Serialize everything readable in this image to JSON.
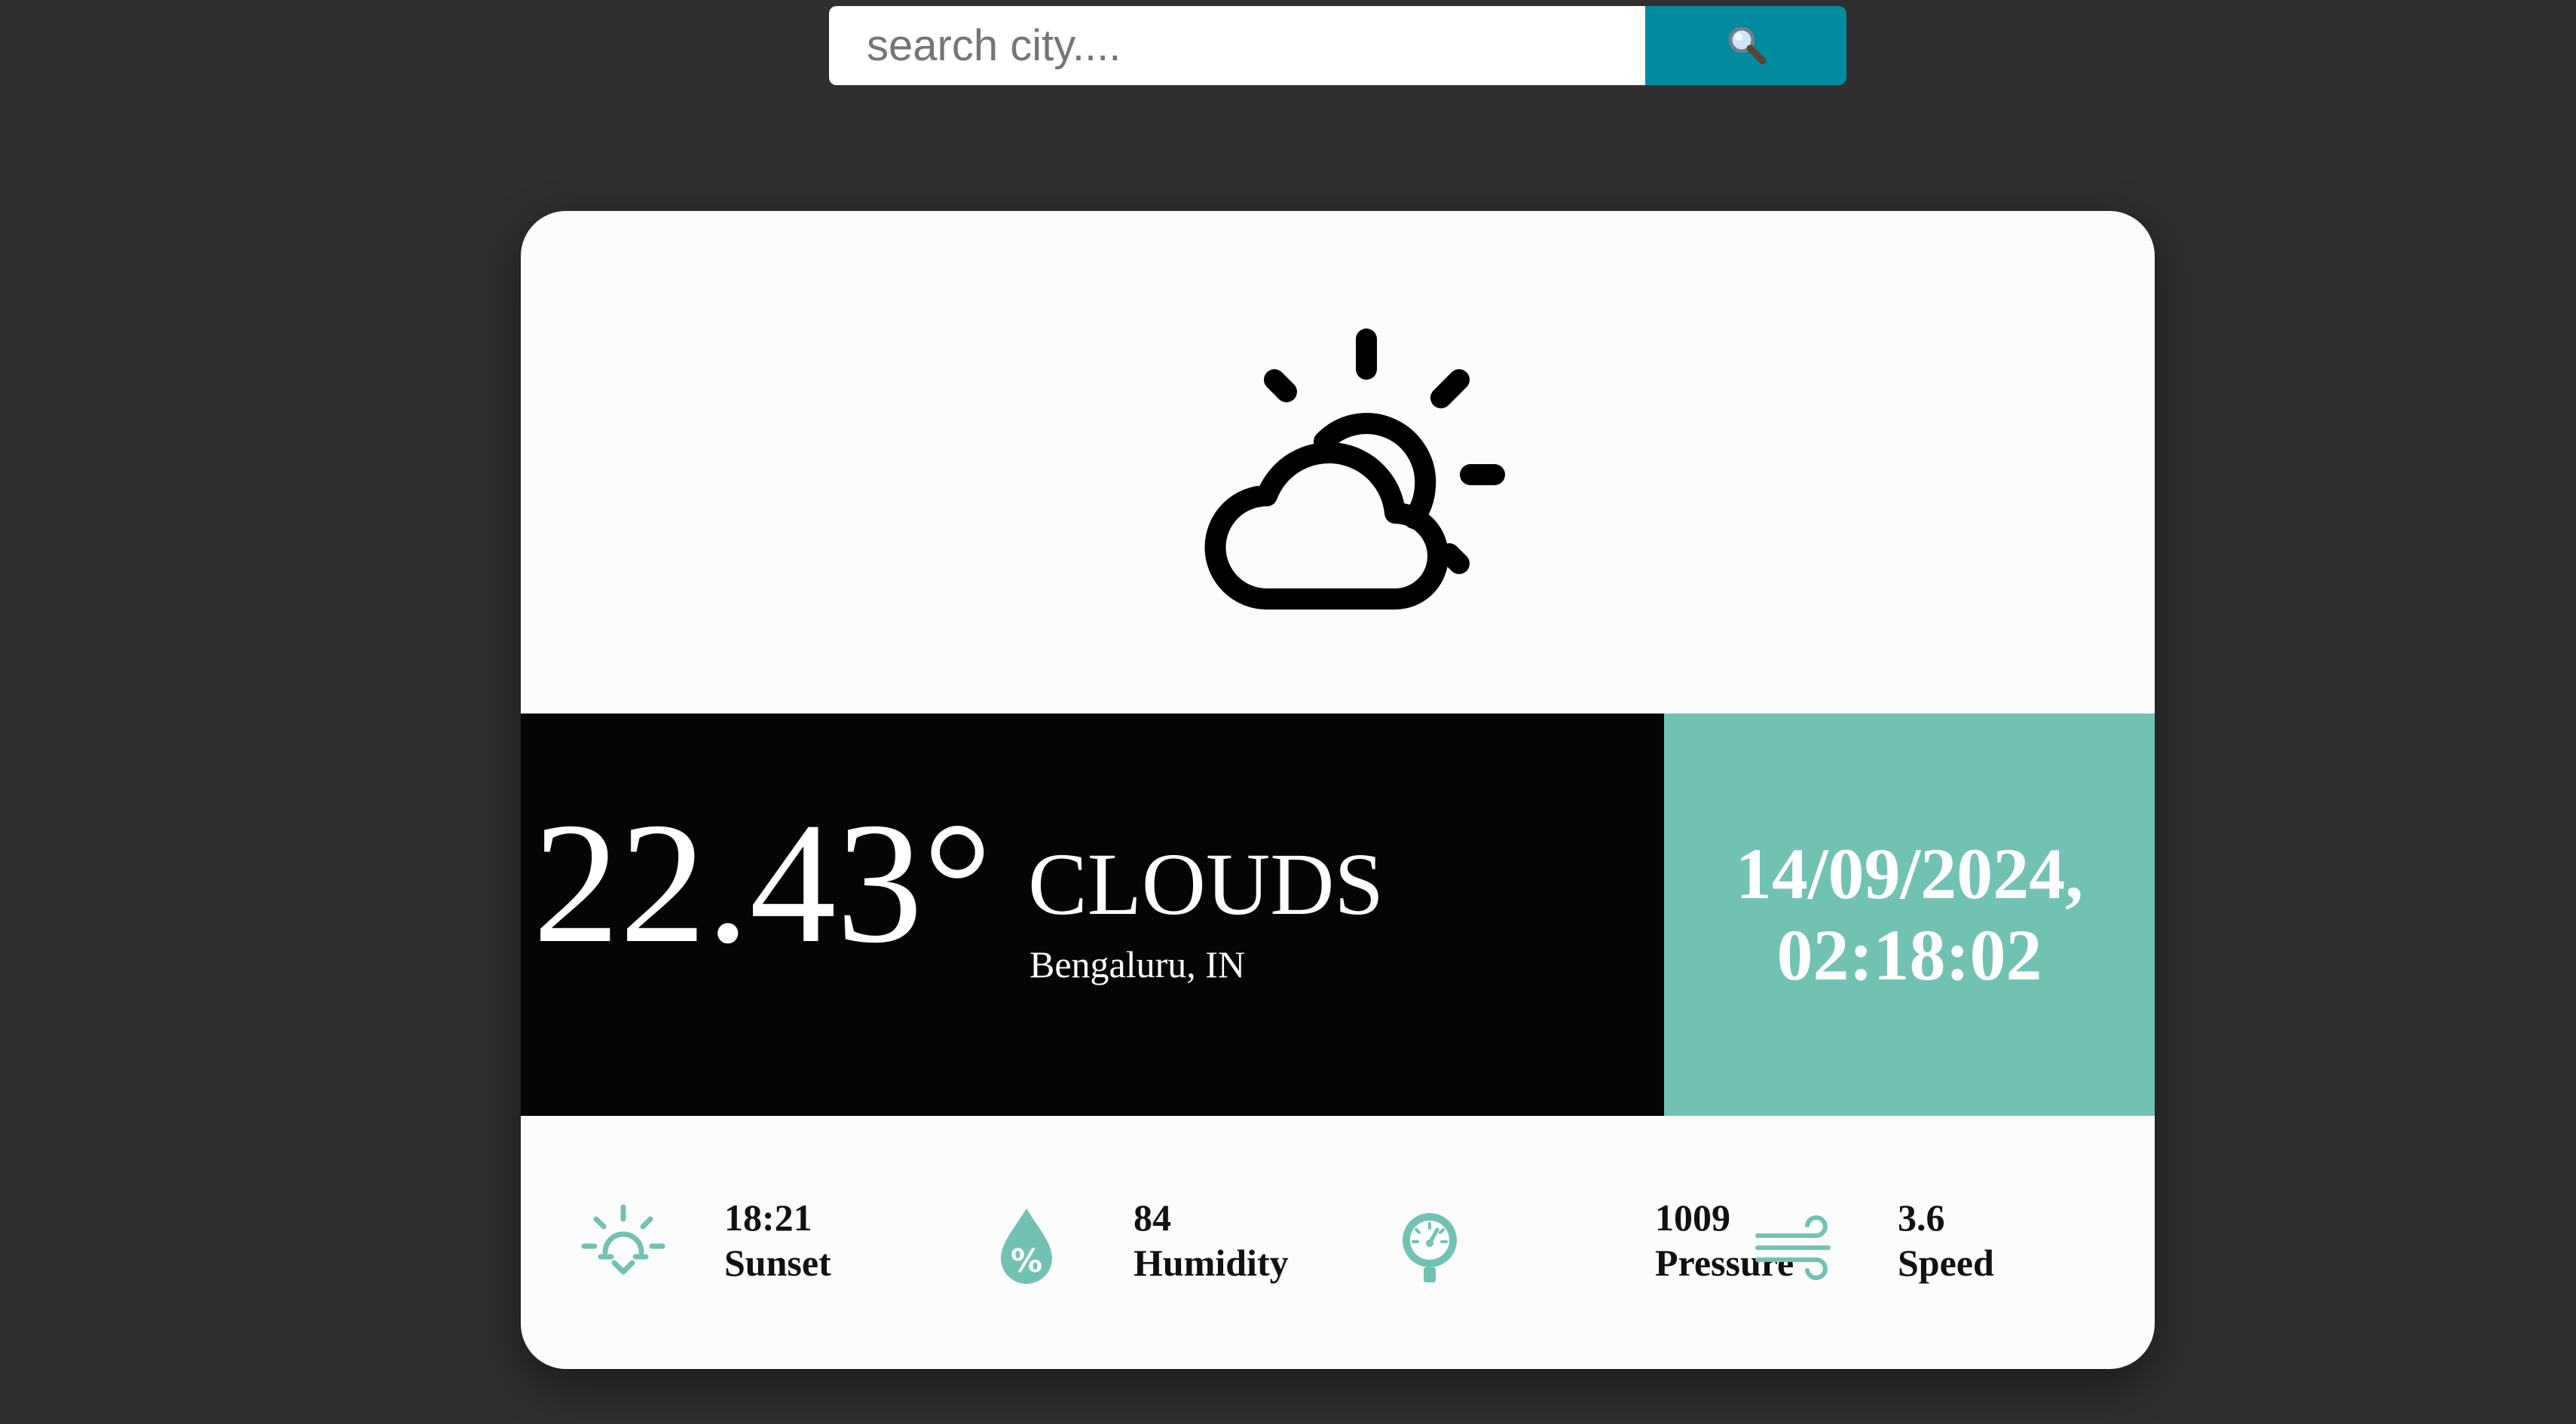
{
  "search": {
    "placeholder": "search city....",
    "button_icon": "magnifying-glass-icon"
  },
  "weather": {
    "icon": "partly-cloudy-icon",
    "temperature": "22.43°",
    "condition": "CLOUDS",
    "location": "Bengaluru, IN"
  },
  "datetime": {
    "date": "14/09/2024,",
    "time": "02:18:02"
  },
  "stats": [
    {
      "icon": "sunset-icon",
      "value": "18:21",
      "label": "Sunset"
    },
    {
      "icon": "humidity-icon",
      "value": "84",
      "label": "Humidity"
    },
    {
      "icon": "pressure-gauge-icon",
      "value": "1009",
      "label": "Pressure"
    },
    {
      "icon": "wind-icon",
      "value": "3.6",
      "label": "Speed"
    }
  ],
  "colors": {
    "background": "#2f2f2f",
    "search_button": "#028a9f",
    "accent": "#72c2b4",
    "main_band": "#060504",
    "card": "#fcfcfc"
  }
}
